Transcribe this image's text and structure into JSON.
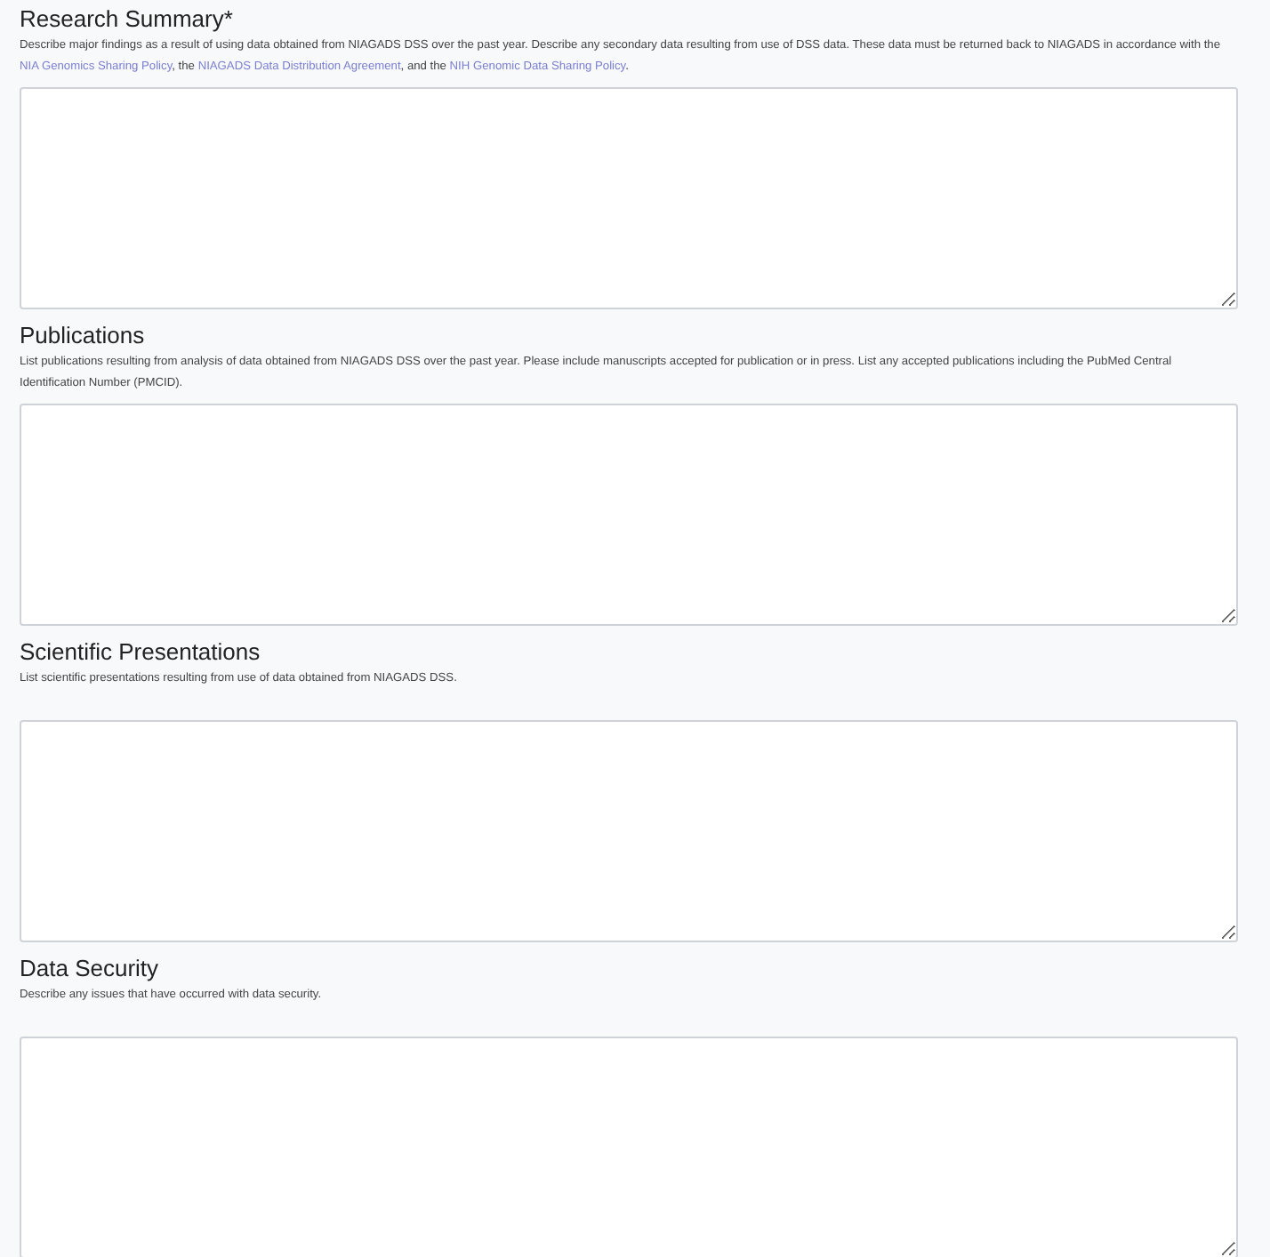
{
  "sections": [
    {
      "heading": "Research Summary*",
      "description": [
        {
          "kind": "text",
          "text": "Describe major findings as a result of using data obtained from NIAGADS DSS over the past year. Describe any secondary data resulting from use of DSS data. These data must be returned back to NIAGADS in accordance with the "
        },
        {
          "kind": "link",
          "text": "NIA Genomics Sharing Policy"
        },
        {
          "kind": "text",
          "text": ", the "
        },
        {
          "kind": "link",
          "text": "NIAGADS Data Distribution Agreement"
        },
        {
          "kind": "text",
          "text": ", and the "
        },
        {
          "kind": "link",
          "text": "NIH Genomic Data Sharing Policy"
        },
        {
          "kind": "text",
          "text": "."
        }
      ]
    },
    {
      "heading": "Publications",
      "description": [
        {
          "kind": "text",
          "text": "List publications resulting from analysis of data obtained from NIAGADS DSS over the past year. Please include manuscripts accepted for publication or in press. List any accepted publications including the PubMed Central Identification Number (PMCID)."
        }
      ]
    },
    {
      "heading": "Scientific Presentations",
      "description": [
        {
          "kind": "text",
          "text": "List scientific presentations resulting from use of data obtained from NIAGADS DSS."
        }
      ]
    },
    {
      "heading": "Data Security",
      "description": [
        {
          "kind": "text",
          "text": "Describe any issues that have occurred with data security."
        }
      ]
    }
  ]
}
